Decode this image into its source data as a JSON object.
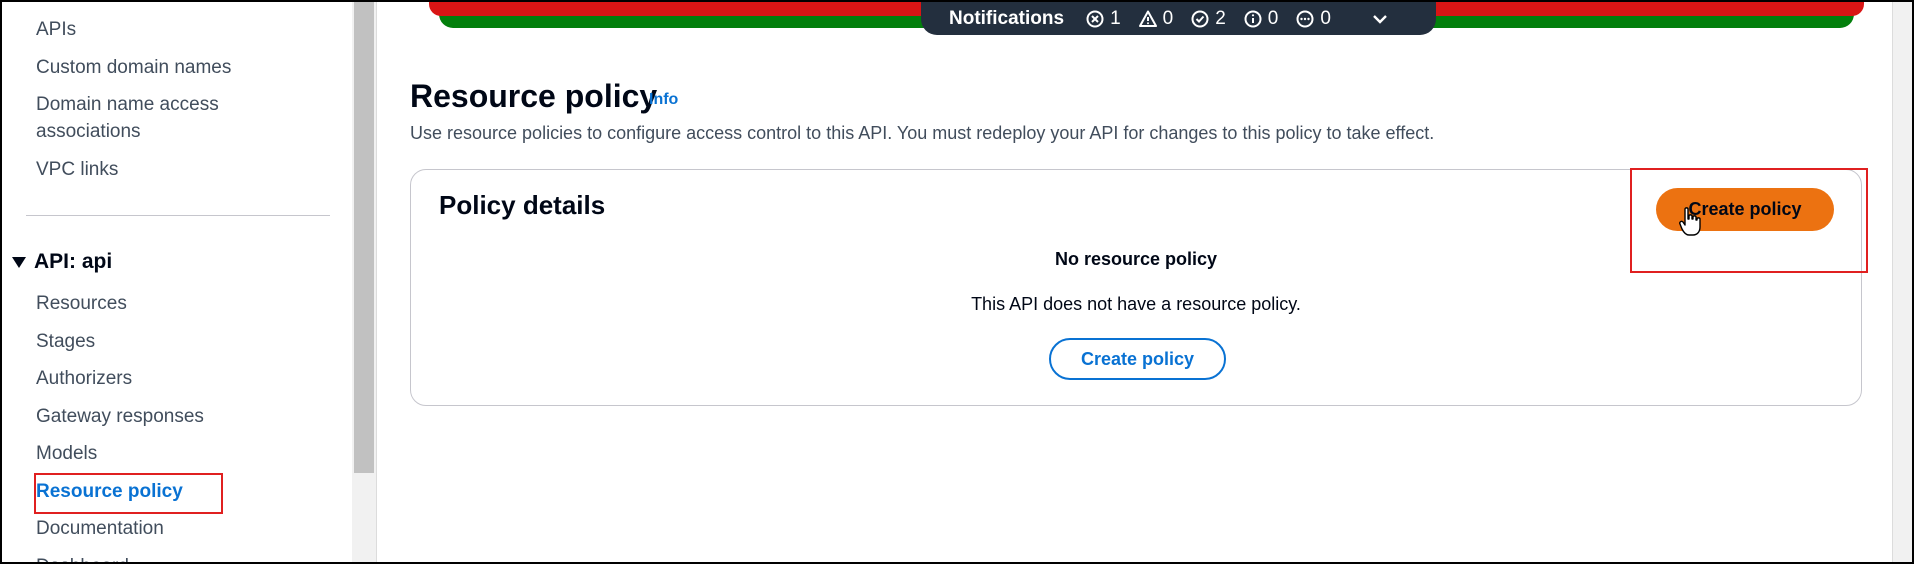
{
  "sidebar": {
    "items_top": [
      {
        "label": "APIs"
      },
      {
        "label": "Custom domain names"
      },
      {
        "label": "Domain name access associations"
      },
      {
        "label": "VPC links"
      }
    ],
    "section": {
      "label": "API: api",
      "items": [
        {
          "label": "Resources"
        },
        {
          "label": "Stages"
        },
        {
          "label": "Authorizers"
        },
        {
          "label": "Gateway responses"
        },
        {
          "label": "Models"
        },
        {
          "label": "Resource policy",
          "active": true
        },
        {
          "label": "Documentation"
        },
        {
          "label": "Dashboard"
        }
      ]
    }
  },
  "notifications": {
    "title": "Notifications",
    "error_count": "1",
    "warning_count": "0",
    "success_count": "2",
    "info_count": "0",
    "in_progress_count": "0"
  },
  "page": {
    "title": "Resource policy",
    "info_label": "Info",
    "description": "Use resource policies to configure access control to this API. You must redeploy your API for changes to this policy to take effect."
  },
  "card": {
    "title": "Policy details",
    "primary_button": "Create policy",
    "empty_title": "No resource policy",
    "empty_description": "This API does not have a resource policy.",
    "empty_button": "Create policy"
  },
  "colors": {
    "primary": "#ec7211",
    "link": "#0972d3",
    "highlight": "#e02020",
    "notification_bg": "#232f3e"
  }
}
